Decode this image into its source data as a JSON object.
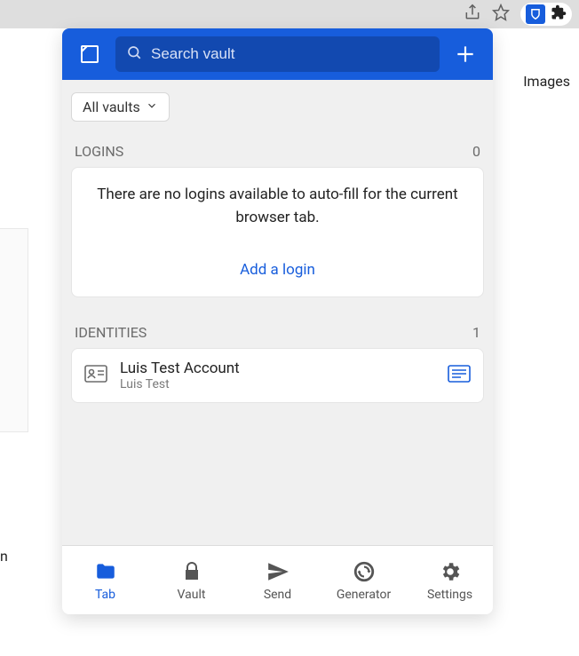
{
  "browser": {
    "share_icon": "share-icon",
    "star_icon": "star-icon",
    "bitwarden_icon": "bitwarden-icon",
    "extensions_icon": "extensions-icon"
  },
  "sidebar": {
    "images_link": "Images",
    "truncated_left": "n"
  },
  "header": {
    "search_placeholder": "Search vault"
  },
  "filter": {
    "label": "All vaults"
  },
  "sections": {
    "logins": {
      "title": "LOGINS",
      "count": "0",
      "empty_message": "There are no logins available to auto-fill for the current browser tab.",
      "add_link": "Add a login"
    },
    "identities": {
      "title": "IDENTITIES",
      "count": "1",
      "items": [
        {
          "name": "Luis Test Account",
          "subtitle": "Luis Test"
        }
      ]
    }
  },
  "nav": {
    "tab": "Tab",
    "vault": "Vault",
    "send": "Send",
    "generator": "Generator",
    "settings": "Settings"
  }
}
